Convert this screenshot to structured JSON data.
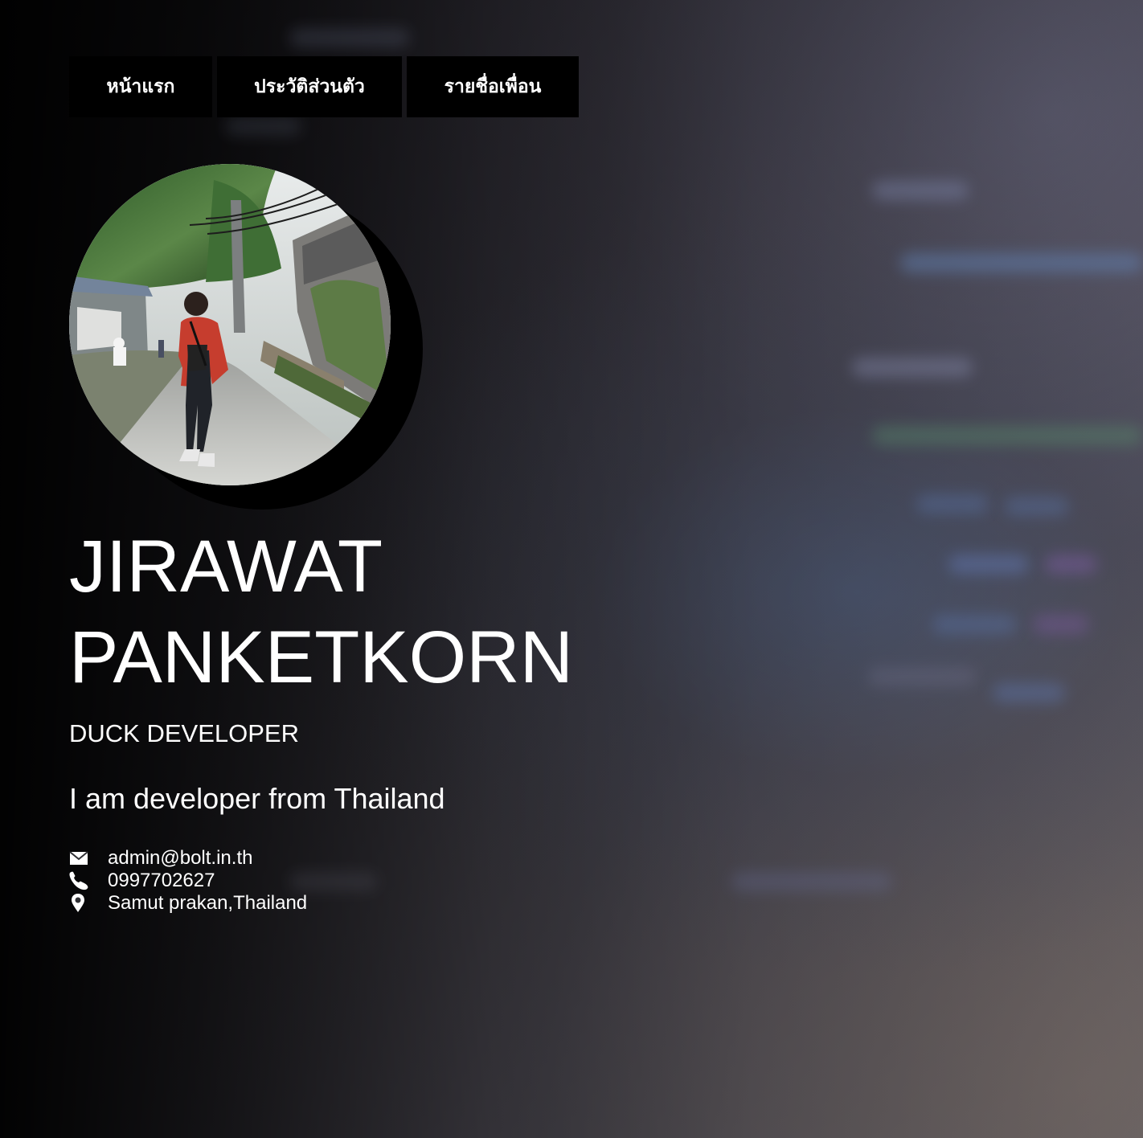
{
  "navigation": {
    "items": [
      {
        "label": "หน้าแรก",
        "name": "home"
      },
      {
        "label": "ประวัติส่วนตัว",
        "name": "profile"
      },
      {
        "label": "รายชื่อเพื่อน",
        "name": "friends"
      }
    ]
  },
  "profile": {
    "first_name": "JIRAWAT",
    "last_name": "PANKETKORN",
    "role": "DUCK DEVELOPER",
    "intro": "I am developer from Thailand"
  },
  "contacts": [
    {
      "icon": "envelope-icon",
      "text": "admin@bolt.in.th"
    },
    {
      "icon": "phone-icon",
      "text": "0997702627"
    },
    {
      "icon": "location-pin-icon",
      "text": "Samut prakan,Thailand"
    }
  ],
  "colors": {
    "text": "#ffffff",
    "nav_background": "#000000",
    "shadow": "#000000"
  }
}
